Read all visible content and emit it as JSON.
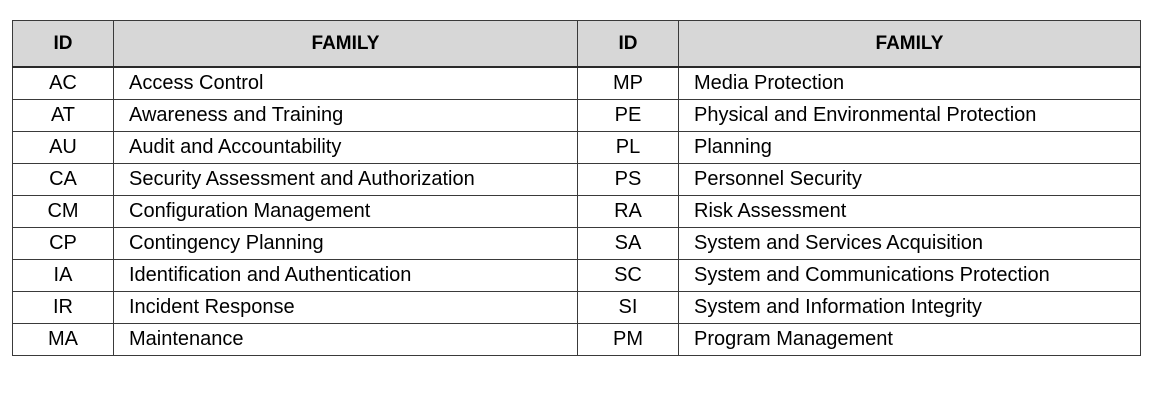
{
  "table": {
    "headers": [
      "ID",
      "FAMILY",
      "ID",
      "FAMILY"
    ],
    "rows": [
      [
        "AC",
        "Access Control",
        "MP",
        "Media Protection"
      ],
      [
        "AT",
        "Awareness and Training",
        "PE",
        "Physical and Environmental Protection"
      ],
      [
        "AU",
        "Audit and Accountability",
        "PL",
        "Planning"
      ],
      [
        "CA",
        "Security Assessment and Authorization",
        "PS",
        "Personnel Security"
      ],
      [
        "CM",
        "Configuration Management",
        "RA",
        "Risk Assessment"
      ],
      [
        "CP",
        "Contingency Planning",
        "SA",
        "System and Services Acquisition"
      ],
      [
        "IA",
        "Identification and Authentication",
        "SC",
        "System and Communications Protection"
      ],
      [
        "IR",
        "Incident Response",
        "SI",
        "System and Information Integrity"
      ],
      [
        "MA",
        "Maintenance",
        "PM",
        "Program Management"
      ]
    ]
  },
  "colors": {
    "header_background": "#d7d7d7",
    "border": "#3a3a3a",
    "text": "#000000"
  }
}
